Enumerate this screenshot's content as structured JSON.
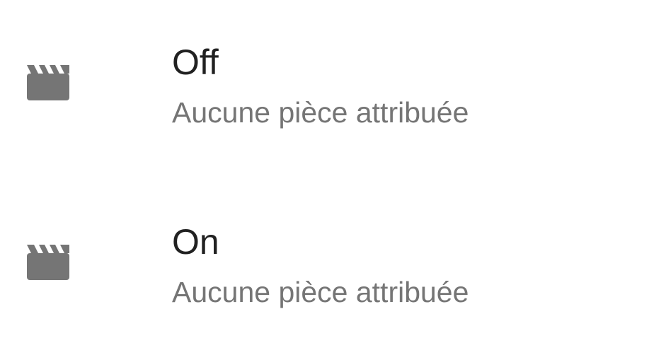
{
  "colors": {
    "background": "#ffffff",
    "title_text": "#212121",
    "subtitle_text": "#757575",
    "icon": "#757575"
  },
  "list": {
    "items": [
      {
        "icon": "clapperboard-icon",
        "title": "Off",
        "subtitle": "Aucune pièce attribuée"
      },
      {
        "icon": "clapperboard-icon",
        "title": "On",
        "subtitle": "Aucune pièce attribuée"
      }
    ]
  }
}
